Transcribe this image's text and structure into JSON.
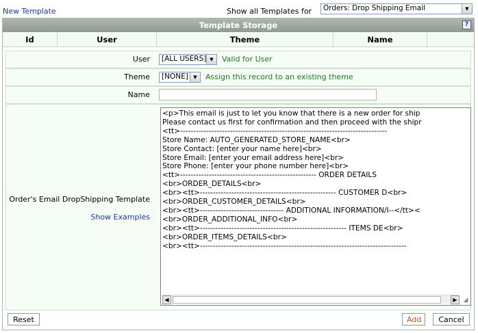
{
  "top": {
    "new_template_link": "New Template",
    "show_all_label": "Show all Templates for",
    "template_type_selected": "Orders: Drop Shipping Email"
  },
  "panel": {
    "title": "Template Storage",
    "help_glyph": "?",
    "columns": [
      "Id",
      "User",
      "Theme",
      "Name"
    ]
  },
  "form": {
    "user_label": "User",
    "user_selected": "[ALL USERS]",
    "user_hint": "Valid for User",
    "theme_label": "Theme",
    "theme_selected": "[NONE]",
    "theme_hint": "Assign this record to an existing theme",
    "name_label": "Name",
    "name_value": "",
    "template_label": "Order's Email DropShipping Template",
    "show_examples_link": "Show Examples",
    "template_lines": [
      "<p>This email is just to let you know that there is a new order for ship",
      "Please contact us first for confirmation and then proceed with the shipr",
      "<tt>-------------------------------------------------------------------------------",
      "Store Name: AUTO_GENERATED_STORE_NAME<br>",
      "Store Contact: [enter your name here]<br>",
      "Store Email: [enter your email address here]<br>",
      "Store Phone: [enter your phone number here]<br>",
      "<tt>---------------------------------------------------- ORDER DETAILS",
      "<br>ORDER_DETAILS<br>",
      "<br><tt>---------------------------------------------------- CUSTOMER D<br>",
      "<br>ORDER_CUSTOMER_DETAILS<br>",
      "<br><tt>-------------------------------- ADDITIONAL INFORMATION/I--</tt><",
      "<br>ORDER_ADDITIONAL_INFO<br>",
      "<br><tt>-------------------------------------------------------- ITEMS DE<br>",
      "<br>ORDER_ITEMS_DETAILS<br>",
      "<br><tt>-------------------------------------------------------------------------------"
    ]
  },
  "buttons": {
    "reset": "Reset",
    "add": "Add",
    "cancel": "Cancel"
  },
  "colors": {
    "add_text": "#c0561a",
    "link": "#1a3a9c",
    "hint": "#1f7a1f"
  }
}
